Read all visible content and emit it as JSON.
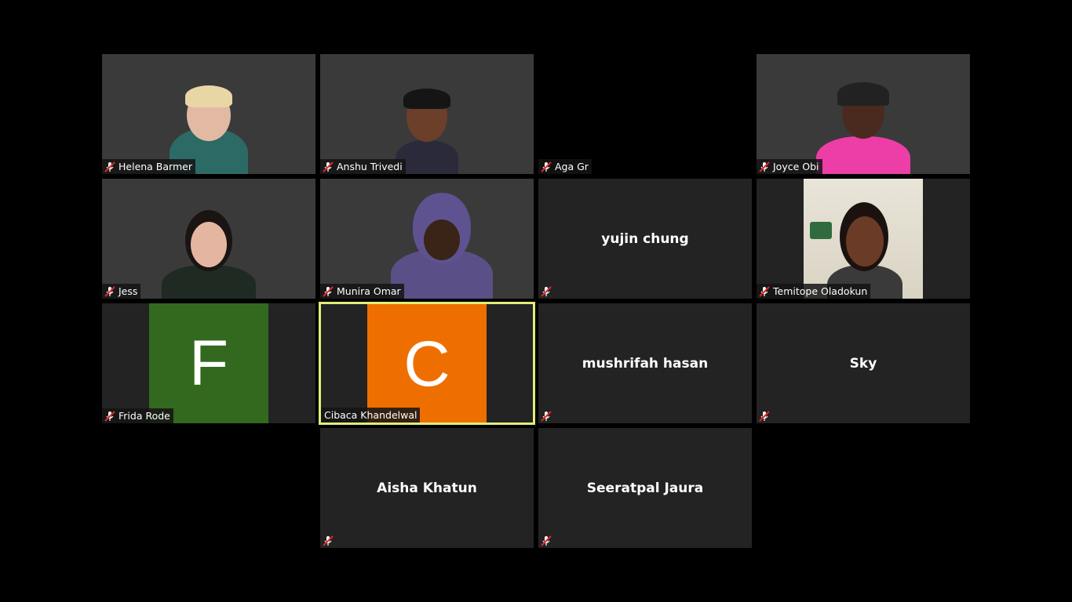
{
  "participants": [
    {
      "name": "Helena Barmer",
      "muted": true,
      "video": true
    },
    {
      "name": "Anshu Trivedi",
      "muted": true,
      "video": true
    },
    {
      "name": "Aga Gr",
      "muted": true,
      "video": false
    },
    {
      "name": "Joyce Obi",
      "muted": true,
      "video": true
    },
    {
      "name": "Jess",
      "muted": true,
      "video": true
    },
    {
      "name": "Munira Omar",
      "muted": true,
      "video": true
    },
    {
      "name": "yujin chung",
      "muted": true,
      "video": false
    },
    {
      "name": "Temitope Oladokun",
      "muted": true,
      "video": true
    },
    {
      "name": "Frida Rode",
      "avatar_letter": "F",
      "avatar_color": "#33691e",
      "muted": true
    },
    {
      "name": "Cibaca Khandelwal",
      "avatar_letter": "C",
      "avatar_color": "#ee6f00",
      "muted": false,
      "active_speaker": true
    },
    {
      "name": "mushrifah hasan",
      "muted": true,
      "video": false
    },
    {
      "name": "Sky",
      "muted": true,
      "video": false
    },
    {
      "name": "Aisha Khatun",
      "muted": true,
      "video": false
    },
    {
      "name": "Seeratpal Jaura",
      "muted": true,
      "video": false
    }
  ],
  "colors": {
    "active_border": "#e2ec7a",
    "muted_icon": "#e02828",
    "tile_bg": "#232323"
  }
}
